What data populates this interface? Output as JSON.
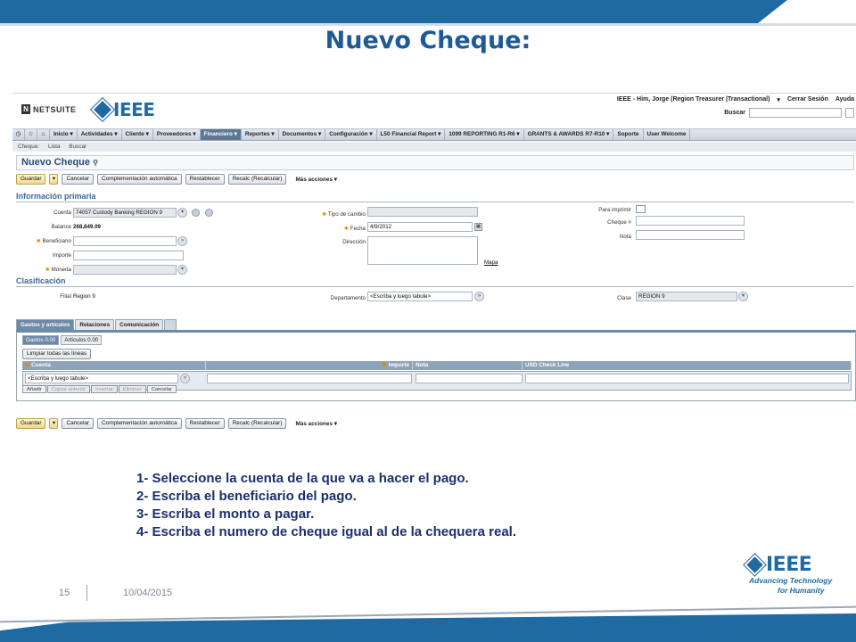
{
  "slide": {
    "title": "Nuevo Cheque:",
    "page_number": "15",
    "date": "10/04/2015",
    "footer_logo": "IEEE",
    "tagline_1": "Advancing Technology",
    "tagline_2": "for Humanity"
  },
  "header": {
    "netsuite_logo": "NETSUITE",
    "ieee_logo": "IEEE",
    "user": "IEEE - Him, Jorge (Region Treasurer |Transactional)",
    "logout": "Cerrar Sesión",
    "help": "Ayuda",
    "search_label": "Buscar"
  },
  "nav": {
    "items": [
      "Inicio",
      "Actividades",
      "Cliente",
      "Proveedores",
      "Financiero",
      "Reportes",
      "Documentos",
      "Configuración",
      "L50 Financial Report",
      "1099 REPORTING R1-R6",
      "GRANTS & AWARDS R7-R10",
      "Soporte",
      "User Welcome"
    ],
    "active_index": 4
  },
  "subnav": {
    "label": "Cheque:",
    "list": "Lista",
    "search": "Buscar"
  },
  "form": {
    "title": "Nuevo Cheque",
    "buttons": {
      "save": "Guardar",
      "cancel": "Cancelar",
      "autofill": "Complementación automática",
      "reset": "Restablecer",
      "recalc": "Recalc (Recalcular)",
      "more": "Más acciones"
    },
    "primary_section": "Información primaria",
    "classification_section": "Clasificación",
    "fields": {
      "account_label": "Cuenta",
      "account_value": "74057 Custody Banking REGION 9",
      "balance_label": "Balance",
      "balance_value": "268,849.09",
      "payee_label": "Beneficiario",
      "amount_label": "Importe",
      "currency_label": "Moneda",
      "exchange_label": "Tipo de cambio",
      "date_label": "Fecha",
      "date_value": "4/9/2012",
      "address_label": "Dirección",
      "map_link": "Mapa",
      "to_print_label": "Para imprimir",
      "check_no_label": "Cheque #",
      "memo_label": "Nota",
      "subsidiary_label": "Filial",
      "subsidiary_value": "Region 9",
      "department_label": "Departamento",
      "department_placeholder": "<Escriba y luego tabule>",
      "class_label": "Clase",
      "class_value": "REGION 9"
    }
  },
  "tabs": {
    "items": [
      "Gastos y artículos",
      "Relaciones",
      "Comunicación"
    ],
    "subtabs": [
      "Gastos 0.00",
      "Artículos 0.00"
    ],
    "clear_lines": "Limpiar todas las líneas",
    "columns": [
      "Cuenta",
      "Importe",
      "Nota",
      "USD Check Line"
    ],
    "row_placeholder": "<Escriba y luego tabule>",
    "row_actions": [
      "Añadir",
      "Copiar anterior",
      "Insertar",
      "Eliminar",
      "Cancelar"
    ]
  },
  "instructions": [
    "1- Seleccione la cuenta de la que va a hacer el pago.",
    "2- Escriba el beneficiario del pago.",
    "3- Escriba el monto a pagar.",
    "4- Escriba el numero de cheque igual al de la chequera real."
  ],
  "colors": {
    "accent": "#1f6aa2",
    "title": "#1f5a96",
    "instructions": "#1b2f6b",
    "nav_active": "#5d7896"
  }
}
